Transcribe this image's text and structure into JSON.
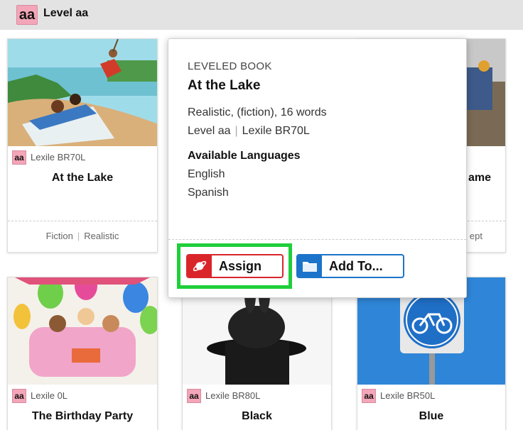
{
  "level": {
    "badge": "aa",
    "title": "Level aa"
  },
  "cards": [
    {
      "badge": "aa",
      "lexile": "Lexile BR70L",
      "title": "At the Lake",
      "genre_a": "Fiction",
      "genre_b": "Realistic"
    },
    {
      "title_fragment": "ame",
      "genre_fragment": "ept"
    },
    {
      "badge": "aa",
      "lexile": "Lexile 0L",
      "title": "The Birthday Party"
    },
    {
      "badge": "aa",
      "lexile": "Lexile BR80L",
      "title": "Black"
    },
    {
      "badge": "aa",
      "lexile": "Lexile BR50L",
      "title": "Blue"
    }
  ],
  "popover": {
    "kind": "LEVELED BOOK",
    "title": "At the Lake",
    "genre_line": "Realistic, (fiction), 16 words",
    "level": "Level aa",
    "lexile": "Lexile BR70L",
    "languages_title": "Available Languages",
    "languages": [
      "English",
      "Spanish"
    ]
  },
  "buttons": {
    "assign": "Assign",
    "add_to": "Add To..."
  },
  "colors": {
    "assign": "#d9252a",
    "add_to": "#1b74c9",
    "highlight": "#1fcf3a",
    "badge": "#f3a6b8"
  },
  "icons": {
    "assign": "planet-icon",
    "add_to": "folder-icon"
  }
}
